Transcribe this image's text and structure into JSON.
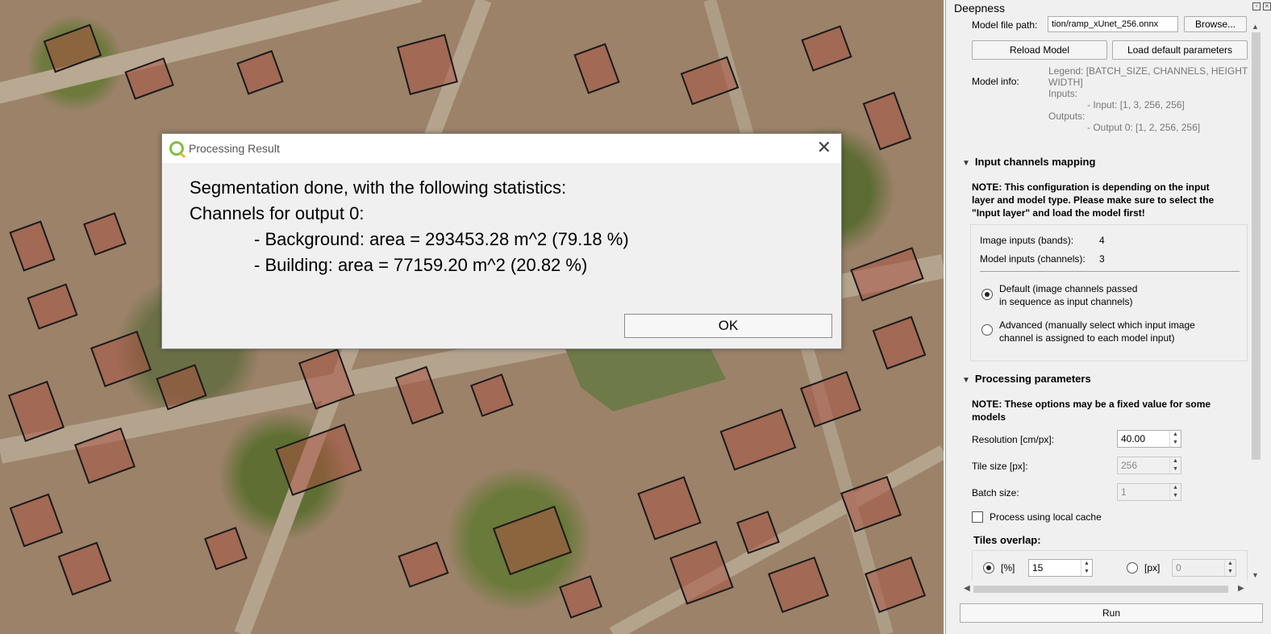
{
  "panel": {
    "title": "Deepness",
    "model_file_label": "Model file path:",
    "model_file_value": "tion/ramp_xUnet_256.onnx",
    "browse_label": "Browse...",
    "reload_label": "Reload Model",
    "load_default_label": "Load default parameters",
    "model_info_label": "Model info:",
    "model_info_lines": [
      "Legend: [BATCH_SIZE, CHANNELS, HEIGHT,",
      "WIDTH]",
      "Inputs:",
      "- Input: [1, 3, 256, 256]",
      "Outputs:",
      "- Output 0: [1, 2, 256, 256]"
    ],
    "channels_section": "Input channels mapping",
    "channels_note": [
      "NOTE: This configuration is depending on the input",
      "layer and model type. Please make sure to select the",
      "\"Input layer\" and load the model first!"
    ],
    "image_inputs_label": "Image inputs (bands):",
    "image_inputs_value": "4",
    "model_inputs_label": "Model inputs (channels):",
    "model_inputs_value": "3",
    "radio_default": [
      "Default (image channels passed",
      "in sequence as input channels)"
    ],
    "radio_advanced": [
      "Advanced (manually select which input image",
      "channel is assigned to each model input)"
    ],
    "processing_section": "Processing parameters",
    "processing_note": [
      "NOTE: These options may be a fixed value for some",
      "models"
    ],
    "resolution_label": "Resolution [cm/px]:",
    "resolution_value": "40.00",
    "tile_label": "Tile size [px]:",
    "tile_value": "256",
    "batch_label": "Batch size:",
    "batch_value": "1",
    "cache_label": "Process using local cache",
    "overlap_label": "Tiles overlap:",
    "overlap_pct_label": "[%]",
    "overlap_pct_value": "15",
    "overlap_px_label": "[px]",
    "overlap_px_value": "0",
    "run_label": "Run"
  },
  "dialog": {
    "title": "Processing Result",
    "lines": [
      "Segmentation done, with the following statistics:",
      "Channels for output 0:",
      "- Background: area = 293453.28 m^2 (79.18 %)",
      "- Building: area = 77159.20 m^2 (20.82 %)"
    ],
    "ok_label": "OK"
  }
}
